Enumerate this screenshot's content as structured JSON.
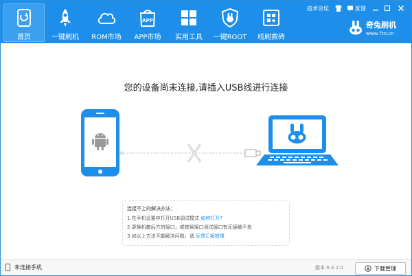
{
  "nav": [
    {
      "label": "首页",
      "icon": "home-icon",
      "active": true
    },
    {
      "label": "一键刷机",
      "icon": "rocket-icon"
    },
    {
      "label": "ROM市场",
      "icon": "cloud-icon"
    },
    {
      "label": "APP市场",
      "icon": "app-bag-icon",
      "badge": "APP"
    },
    {
      "label": "实用工具",
      "icon": "grid-icon"
    },
    {
      "label": "一键ROOT",
      "icon": "shield-icon"
    },
    {
      "label": "线刷救砖",
      "icon": "tools-icon"
    }
  ],
  "window_top": {
    "forum": "技术论坛",
    "feedback": "反馈"
  },
  "brand": {
    "name": "奇兔刷机",
    "url": "www.7to.cn"
  },
  "main": {
    "headline": "您的设备尚未连接,请插入USB线进行连接",
    "help": {
      "title": "连接不上的解决办法：",
      "line1": "1.在手机设置中打开USB调试模式",
      "line1_link": "如何打开?",
      "line2": "2.更换机箱后方的接口，或按紧接口测试接口有无接触不良",
      "line3": "3.如以上方法不能解决问题，请",
      "line3_link": "反馈汇报故障"
    }
  },
  "status": {
    "device": "未连接手机",
    "version": "版本:6.4.2.0",
    "download": "下载管理"
  },
  "colors": {
    "primary": "#1d8ee9",
    "link": "#1d8ee9"
  }
}
